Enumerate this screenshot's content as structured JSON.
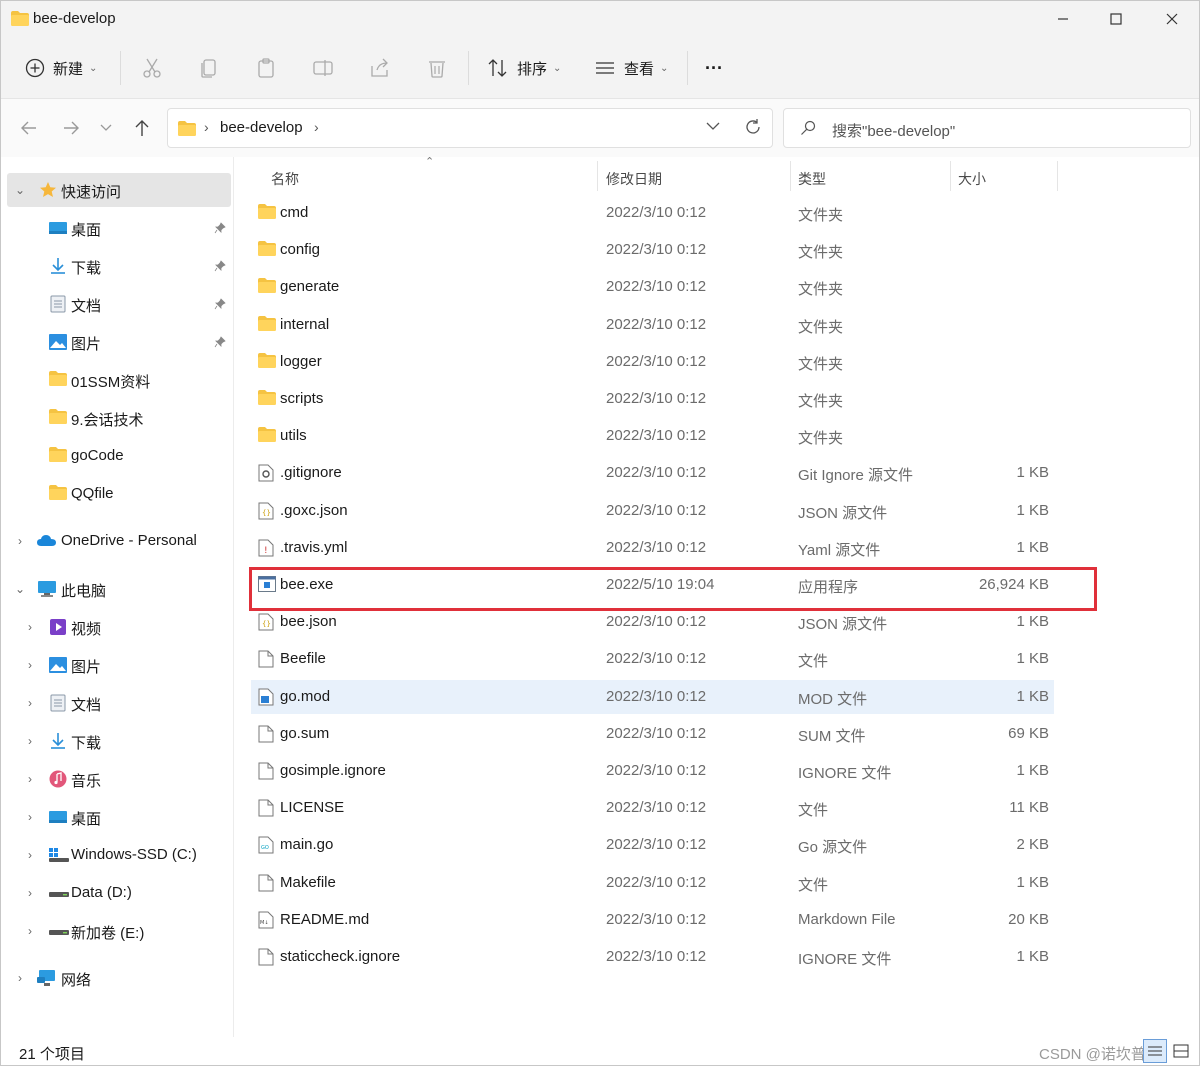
{
  "window": {
    "title": "bee-develop"
  },
  "toolbar": {
    "new_label": "新建",
    "sort_label": "排序",
    "view_label": "查看",
    "more_label": "···"
  },
  "address": {
    "crumb": "bee-develop",
    "search_placeholder": "搜索\"bee-develop\""
  },
  "sidebar": {
    "quick_access": "快速访问",
    "quick_items": [
      "桌面",
      "下载",
      "文档",
      "图片",
      "01SSM资料",
      "9.会话技术",
      "goCode",
      "QQfile"
    ],
    "onedrive": "OneDrive - Personal",
    "this_pc": "此电脑",
    "pc_items": [
      "视频",
      "图片",
      "文档",
      "下载",
      "音乐",
      "桌面",
      "Windows-SSD (C:)",
      "Data (D:)",
      "新加卷 (E:)"
    ],
    "network": "网络"
  },
  "columns": {
    "name": "名称",
    "date": "修改日期",
    "type": "类型",
    "size": "大小"
  },
  "files": [
    {
      "name": "cmd",
      "date": "2022/3/10 0:12",
      "type": "文件夹",
      "size": "",
      "icon": "folder"
    },
    {
      "name": "config",
      "date": "2022/3/10 0:12",
      "type": "文件夹",
      "size": "",
      "icon": "folder"
    },
    {
      "name": "generate",
      "date": "2022/3/10 0:12",
      "type": "文件夹",
      "size": "",
      "icon": "folder"
    },
    {
      "name": "internal",
      "date": "2022/3/10 0:12",
      "type": "文件夹",
      "size": "",
      "icon": "folder"
    },
    {
      "name": "logger",
      "date": "2022/3/10 0:12",
      "type": "文件夹",
      "size": "",
      "icon": "folder"
    },
    {
      "name": "scripts",
      "date": "2022/3/10 0:12",
      "type": "文件夹",
      "size": "",
      "icon": "folder"
    },
    {
      "name": "utils",
      "date": "2022/3/10 0:12",
      "type": "文件夹",
      "size": "",
      "icon": "folder"
    },
    {
      "name": ".gitignore",
      "date": "2022/3/10 0:12",
      "type": "Git Ignore 源文件",
      "size": "1 KB",
      "icon": "gear-file"
    },
    {
      "name": ".goxc.json",
      "date": "2022/3/10 0:12",
      "type": "JSON 源文件",
      "size": "1 KB",
      "icon": "json-file"
    },
    {
      "name": ".travis.yml",
      "date": "2022/3/10 0:12",
      "type": "Yaml 源文件",
      "size": "1 KB",
      "icon": "yaml-file"
    },
    {
      "name": "bee.exe",
      "date": "2022/5/10 19:04",
      "type": "应用程序",
      "size": "26,924 KB",
      "icon": "exe"
    },
    {
      "name": "bee.json",
      "date": "2022/3/10 0:12",
      "type": "JSON 源文件",
      "size": "1 KB",
      "icon": "json-file"
    },
    {
      "name": "Beefile",
      "date": "2022/3/10 0:12",
      "type": "文件",
      "size": "1 KB",
      "icon": "file"
    },
    {
      "name": "go.mod",
      "date": "2022/3/10 0:12",
      "type": "MOD 文件",
      "size": "1 KB",
      "icon": "mod-file"
    },
    {
      "name": "go.sum",
      "date": "2022/3/10 0:12",
      "type": "SUM 文件",
      "size": "69 KB",
      "icon": "file"
    },
    {
      "name": "gosimple.ignore",
      "date": "2022/3/10 0:12",
      "type": "IGNORE 文件",
      "size": "1 KB",
      "icon": "file"
    },
    {
      "name": "LICENSE",
      "date": "2022/3/10 0:12",
      "type": "文件",
      "size": "11 KB",
      "icon": "file"
    },
    {
      "name": "main.go",
      "date": "2022/3/10 0:12",
      "type": "Go 源文件",
      "size": "2 KB",
      "icon": "go-file"
    },
    {
      "name": "Makefile",
      "date": "2022/3/10 0:12",
      "type": "文件",
      "size": "1 KB",
      "icon": "file"
    },
    {
      "name": "README.md",
      "date": "2022/3/10 0:12",
      "type": "Markdown File",
      "size": "20 KB",
      "icon": "md-file"
    },
    {
      "name": "staticcheck.ignore",
      "date": "2022/3/10 0:12",
      "type": "IGNORE 文件",
      "size": "1 KB",
      "icon": "file"
    }
  ],
  "status": {
    "count": "21 个项目",
    "watermark": "CSDN @诺坎普"
  },
  "colors": {
    "folder": "#f5c342",
    "selection": "#e8f1fb",
    "highlight_border": "#e0303a"
  }
}
